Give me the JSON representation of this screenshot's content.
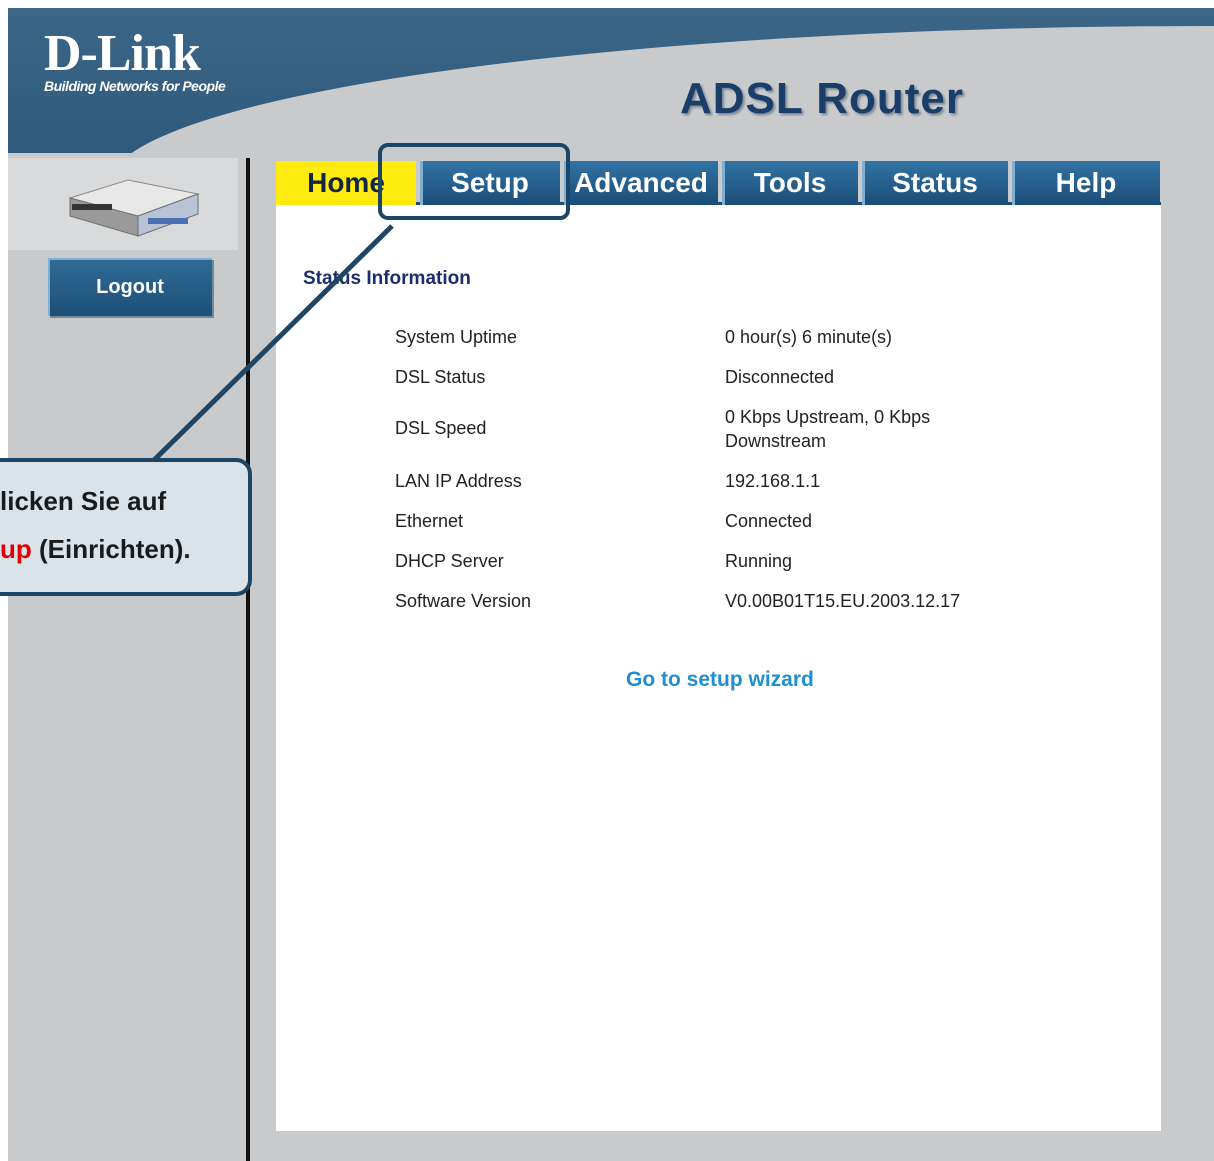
{
  "header": {
    "brand": "D-Link",
    "tagline": "Building Networks for People",
    "product_title": "ADSL Router"
  },
  "sidebar": {
    "logout_label": "Logout"
  },
  "tabs": [
    {
      "label": "Home",
      "active": true
    },
    {
      "label": "Setup",
      "active": false
    },
    {
      "label": "Advanced",
      "active": false
    },
    {
      "label": "Tools",
      "active": false
    },
    {
      "label": "Status",
      "active": false
    },
    {
      "label": "Help",
      "active": false
    }
  ],
  "status": {
    "heading": "Status Information",
    "rows": [
      {
        "label": "System Uptime",
        "value": "0 hour(s) 6 minute(s)"
      },
      {
        "label": "DSL Status",
        "value": "Disconnected"
      },
      {
        "label": "DSL Speed",
        "value": "0 Kbps Upstream, 0 Kbps Downstream"
      },
      {
        "label": "LAN IP Address",
        "value": "192.168.1.1"
      },
      {
        "label": "Ethernet",
        "value": "Connected"
      },
      {
        "label": "DHCP Server",
        "value": "Running"
      },
      {
        "label": "Software Version",
        "value": "V0.00B01T15.EU.2003.12.17"
      }
    ],
    "wizard_link": "Go to setup wizard"
  },
  "callout": {
    "line1": "licken Sie auf",
    "line2_red": "up",
    "line2_rest": " (Einrichten)."
  },
  "colors": {
    "header_blue": "#2f5a7c",
    "tab_active": "#ffeb10",
    "tab_blue": "#1b4d78",
    "link": "#1f8fd2",
    "callout_accent": "#e00000"
  }
}
